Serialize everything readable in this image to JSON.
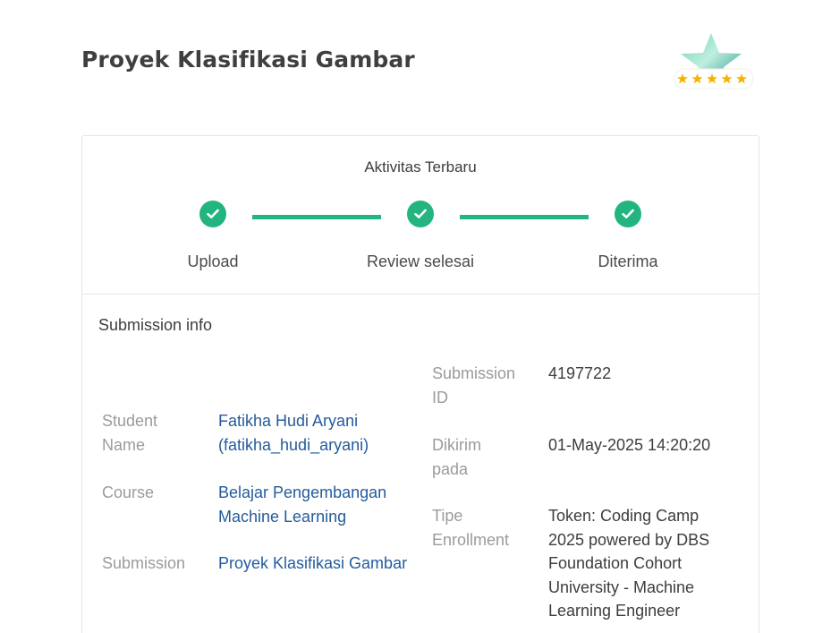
{
  "header": {
    "title": "Proyek Klasifikasi Gambar"
  },
  "activity": {
    "title": "Aktivitas Terbaru",
    "steps": [
      {
        "label": "Upload"
      },
      {
        "label": "Review selesai"
      },
      {
        "label": "Diterima"
      }
    ],
    "accent_color": "#23b57f"
  },
  "submission_info": {
    "title": "Submission info",
    "left": {
      "student_label_1": "Student",
      "student_label_2": "Name",
      "student_value_1": "Fatikha Hudi Aryani",
      "student_value_2": "(fatikha_hudi_aryani)",
      "course_label": "Course",
      "course_value_1": "Belajar Pengembangan",
      "course_value_2": "Machine Learning",
      "submission_label": "Submission",
      "submission_value": "Proyek Klasifikasi Gambar"
    },
    "right": {
      "id_label_1": "Submission",
      "id_label_2": "ID",
      "id_value": "4197722",
      "sent_label_1": "Dikirim",
      "sent_label_2": "pada",
      "sent_value": "01-May-2025 14:20:20",
      "type_label_1": "Tipe",
      "type_label_2": "Enrollment",
      "type_value_lines": [
        "Token: Coding Camp",
        "2025 powered by DBS",
        "Foundation Cohort",
        "University - Machine",
        "Learning Engineer"
      ]
    }
  },
  "icons": {
    "badge": "star-rating-badge-icon",
    "check": "check-icon"
  }
}
